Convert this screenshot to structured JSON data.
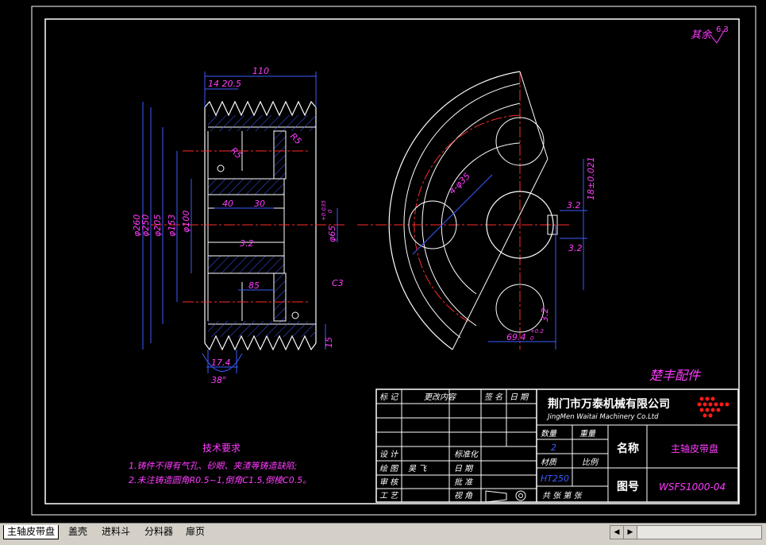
{
  "roughness_note": "其余",
  "roughness_value": "6.3",
  "left_view": {
    "dim_top_total": "110",
    "dim_top_parts": "14 20.5",
    "dia_260": "φ260",
    "dia_250": "φ250",
    "dia_205": "φ205",
    "dia_153": "φ153",
    "dia_100": "φ100",
    "bore": "φ65",
    "bore_tol_up": "+0.035",
    "bore_tol_low": "0",
    "r5a": "R5",
    "r5b": "R5",
    "dim_40": "40",
    "dim_30": "30",
    "rough_mid": "3.2",
    "dim_85": "85",
    "chamfer": "C3",
    "dim_15": "15",
    "dim_174": "17.4",
    "angle_38": "38°"
  },
  "right_view": {
    "holes": "4-φ35",
    "keyway": "18±0.021",
    "rough_1": "3.2",
    "rough_2": "3.2",
    "rough_3": "3.2",
    "dim_694": "69.4",
    "dim_694_tol": "+0.2",
    "dim_694_tol_low": "0"
  },
  "supplier": "楚丰配件",
  "tech_req": {
    "title": "技术要求",
    "line1": "1.铸件不得有气孔、砂眼、夹渣等铸造缺陷;",
    "line2": "2.未注铸造圆角R0.5~1,倒角C1.5,倒棱C0.5。"
  },
  "title_block": {
    "h_mark": "标 记",
    "h_change": "更改内容",
    "h_sign": "签 名",
    "h_date": "日 期",
    "company_cn": "荆门市万泰机械有限公司",
    "company_en": "JingMen Waitai Machinery Co.Ltd",
    "qty_label": "数量",
    "qty_value": "2",
    "weight_label": "重量",
    "material_label": "材质",
    "material_value": "HT250",
    "scale_label": "比例",
    "name_label": "名称",
    "name_value": "主轴皮带盘",
    "drawing_no_label": "图号",
    "drawing_no_value": "WSFS1000-04",
    "design": "设 计",
    "standardize": "标准化",
    "draw": "绘 图",
    "drafter": "吴 飞",
    "date": "日 期",
    "review": "审 核",
    "approve": "批 准",
    "process": "工 艺",
    "projection": "视 角",
    "sheets": "共  张  第  张"
  },
  "tabs": [
    "主轴皮带盘",
    "盖壳",
    "进料斗",
    "分料器",
    "扉页"
  ],
  "active_tab": 0
}
